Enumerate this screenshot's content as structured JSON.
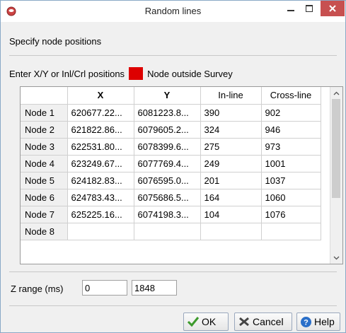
{
  "window": {
    "title": "Random lines"
  },
  "heading": "Specify node positions",
  "instruction": "Enter X/Y or Inl/Crl positions",
  "legend_label": "Node outside Survey",
  "colors": {
    "outside_marker": "#dd0000",
    "close_button": "#c75050"
  },
  "table": {
    "headers": [
      "X",
      "Y",
      "In-line",
      "Cross-line"
    ],
    "rows": [
      {
        "label": "Node 1",
        "x": "620677.22...",
        "y": "6081223.8...",
        "inline": "390",
        "crossline": "902"
      },
      {
        "label": "Node 2",
        "x": "621822.86...",
        "y": "6079605.2...",
        "inline": "324",
        "crossline": "946"
      },
      {
        "label": "Node 3",
        "x": "622531.80...",
        "y": "6078399.6...",
        "inline": "275",
        "crossline": "973"
      },
      {
        "label": "Node 4",
        "x": "623249.67...",
        "y": "6077769.4...",
        "inline": "249",
        "crossline": "1001"
      },
      {
        "label": "Node 5",
        "x": "624182.83...",
        "y": "6076595.0...",
        "inline": "201",
        "crossline": "1037"
      },
      {
        "label": "Node 6",
        "x": "624783.43...",
        "y": "6075686.5...",
        "inline": "164",
        "crossline": "1060"
      },
      {
        "label": "Node 7",
        "x": "625225.16...",
        "y": "6074198.3...",
        "inline": "104",
        "crossline": "1076"
      },
      {
        "label": "Node 8",
        "x": "",
        "y": "",
        "inline": "",
        "crossline": ""
      }
    ]
  },
  "zrange": {
    "label": "Z range (ms)",
    "start": "0",
    "stop": "1848"
  },
  "buttons": {
    "ok": "OK",
    "cancel": "Cancel",
    "help": "Help"
  }
}
